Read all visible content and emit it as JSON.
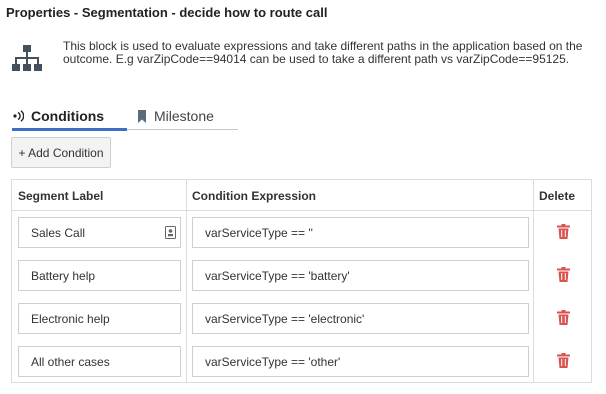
{
  "panel": {
    "title": "Properties - Segmentation - decide how to route call",
    "description": "This block is used to evaluate expressions and take different paths in the application based on the outcome. E.g varZipCode==94014 can be used to take a different path vs varZipCode==95125.",
    "icon": "hierarchy-icon"
  },
  "tabs": [
    {
      "label": "Conditions",
      "icon": "conditions-icon",
      "active": true
    },
    {
      "label": "Milestone",
      "icon": "bookmark-icon",
      "active": false
    }
  ],
  "toolbar": {
    "add_label": "+ Add Condition"
  },
  "table": {
    "headers": {
      "label": "Segment Label",
      "expression": "Condition Expression",
      "delete": "Delete"
    },
    "rows": [
      {
        "label": "Sales Call",
        "expression": "varServiceType == ''"
      },
      {
        "label": "Battery help",
        "expression": "varServiceType == 'battery'"
      },
      {
        "label": "Electronic help",
        "expression": "varServiceType == 'electronic'"
      },
      {
        "label": "All other cases",
        "expression": "varServiceType == 'other'"
      }
    ]
  },
  "colors": {
    "accent": "#3b6fc6",
    "delete": "#d9534f"
  }
}
